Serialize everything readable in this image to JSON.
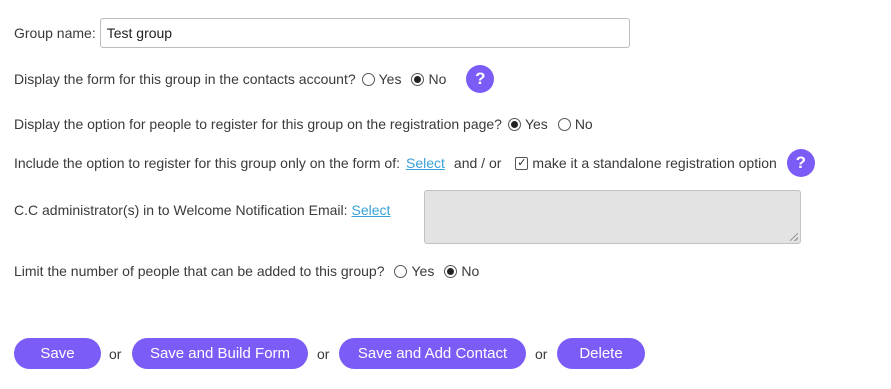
{
  "group_name": {
    "label": "Group name:",
    "value": "Test group"
  },
  "display_form": {
    "question": "Display the form for this group in the contacts account?",
    "options": [
      {
        "label": "Yes",
        "selected": false
      },
      {
        "label": "No",
        "selected": true
      }
    ],
    "help": "?"
  },
  "display_option": {
    "question": "Display the option for people to register for this group on the registration page?",
    "options": [
      {
        "label": "Yes",
        "selected": true
      },
      {
        "label": "No",
        "selected": false
      }
    ]
  },
  "include_option": {
    "label": "Include the option to register for this group only on the form of:",
    "select_link": "Select",
    "connector": "and / or",
    "checkbox_label": "make it a standalone registration option",
    "checkbox_checked": true,
    "help": "?"
  },
  "cc_admin": {
    "label": "C.C administrator(s) in to Welcome Notification Email:",
    "select_link": "Select"
  },
  "limit": {
    "question": "Limit the number of people that can be added to this group?",
    "options": [
      {
        "label": "Yes",
        "selected": false
      },
      {
        "label": "No",
        "selected": true
      }
    ]
  },
  "actions": {
    "save": "Save",
    "save_build": "Save and Build Form",
    "save_add": "Save and Add Contact",
    "delete": "Delete",
    "or": "or"
  },
  "colors": {
    "accent": "#7b5cf6",
    "link": "#3aa0d8"
  }
}
